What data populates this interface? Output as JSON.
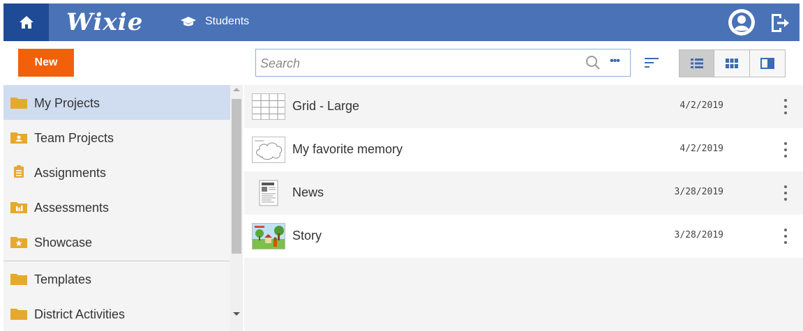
{
  "header": {
    "logo_text": "Wixie",
    "breadcrumb_label": "Students",
    "home_icon": "home-icon",
    "breadcrumb_icon": "graduation-cap-icon",
    "account_icon": "account-circle-icon",
    "logout_icon": "logout-icon",
    "bar_color": "#4a72b6",
    "home_bg_color": "#1f4b96"
  },
  "toolbar": {
    "new_label": "New",
    "new_color": "#f2600c",
    "search_placeholder": "Search",
    "search_value": "",
    "more_label": "•••",
    "views": [
      {
        "icon": "list-view-icon",
        "active": true
      },
      {
        "icon": "grid-view-icon",
        "active": false
      },
      {
        "icon": "preview-pane-icon",
        "active": false
      }
    ]
  },
  "sidebar": {
    "items": [
      {
        "label": "My Projects",
        "icon": "folder-icon",
        "selected": true
      },
      {
        "label": "Team Projects",
        "icon": "team-folder-icon",
        "selected": false
      },
      {
        "label": "Assignments",
        "icon": "clipboard-icon",
        "selected": false
      },
      {
        "label": "Assessments",
        "icon": "assessment-folder-icon",
        "selected": false
      },
      {
        "label": "Showcase",
        "icon": "star-folder-icon",
        "selected": false
      },
      {
        "label": "Templates",
        "icon": "folder-icon",
        "selected": false
      },
      {
        "label": "District Activities",
        "icon": "folder-icon",
        "selected": false
      }
    ],
    "selected_color": "#d0ddf0",
    "folder_color": "#e6a92e"
  },
  "projects": [
    {
      "title": "Grid - Large",
      "date": "4/2/2019",
      "thumbnail": "grid-thumbnail"
    },
    {
      "title": "My favorite memory",
      "date": "4/2/2019",
      "thumbnail": "cloud-thumbnail"
    },
    {
      "title": "News",
      "date": "3/28/2019",
      "thumbnail": "newspaper-thumbnail"
    },
    {
      "title": "Story",
      "date": "3/28/2019",
      "thumbnail": "story-scene-thumbnail"
    }
  ]
}
